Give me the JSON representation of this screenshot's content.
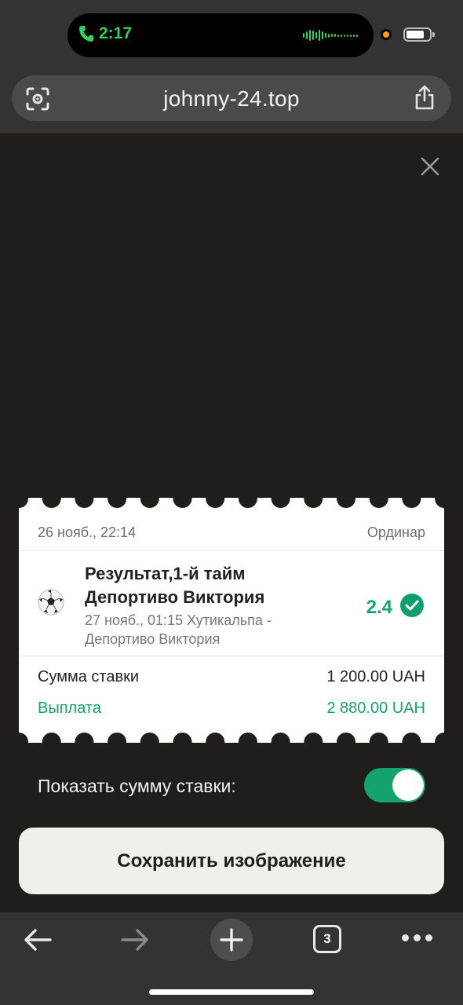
{
  "status_bar": {
    "time": "2:17"
  },
  "browser": {
    "url": "johnny-24.top"
  },
  "ticket": {
    "date": "26 нояб., 22:14",
    "bet_type": "Ординар",
    "market": "Результат,1-й тайм",
    "selection": "Депортиво Виктория",
    "match_info": "27 нояб., 01:15 Хутикальпа - Депортиво Виктория",
    "odds": "2.4",
    "stake_label": "Сумма ставки",
    "stake_value": "1 200.00 UAH",
    "payout_label": "Выплата",
    "payout_value": "2 880.00 UAH"
  },
  "toggle": {
    "label": "Показать сумму ставки:",
    "on": true
  },
  "save_button": {
    "label": "Сохранить изображение"
  },
  "toolbar": {
    "tab_count": "3"
  },
  "colors": {
    "accent_green": "#14a36c",
    "odds_green": "#14a37a",
    "status_green": "#30d158",
    "overlay_bg": "#1f1e1c"
  },
  "icons": [
    "phone-icon",
    "audio-wave-icon",
    "battery-icon",
    "visual-lookup-icon",
    "share-icon",
    "close-icon",
    "soccer-ball-icon",
    "check-icon",
    "back-arrow-icon",
    "forward-arrow-icon",
    "new-tab-icon",
    "tabs-icon",
    "more-icon"
  ]
}
